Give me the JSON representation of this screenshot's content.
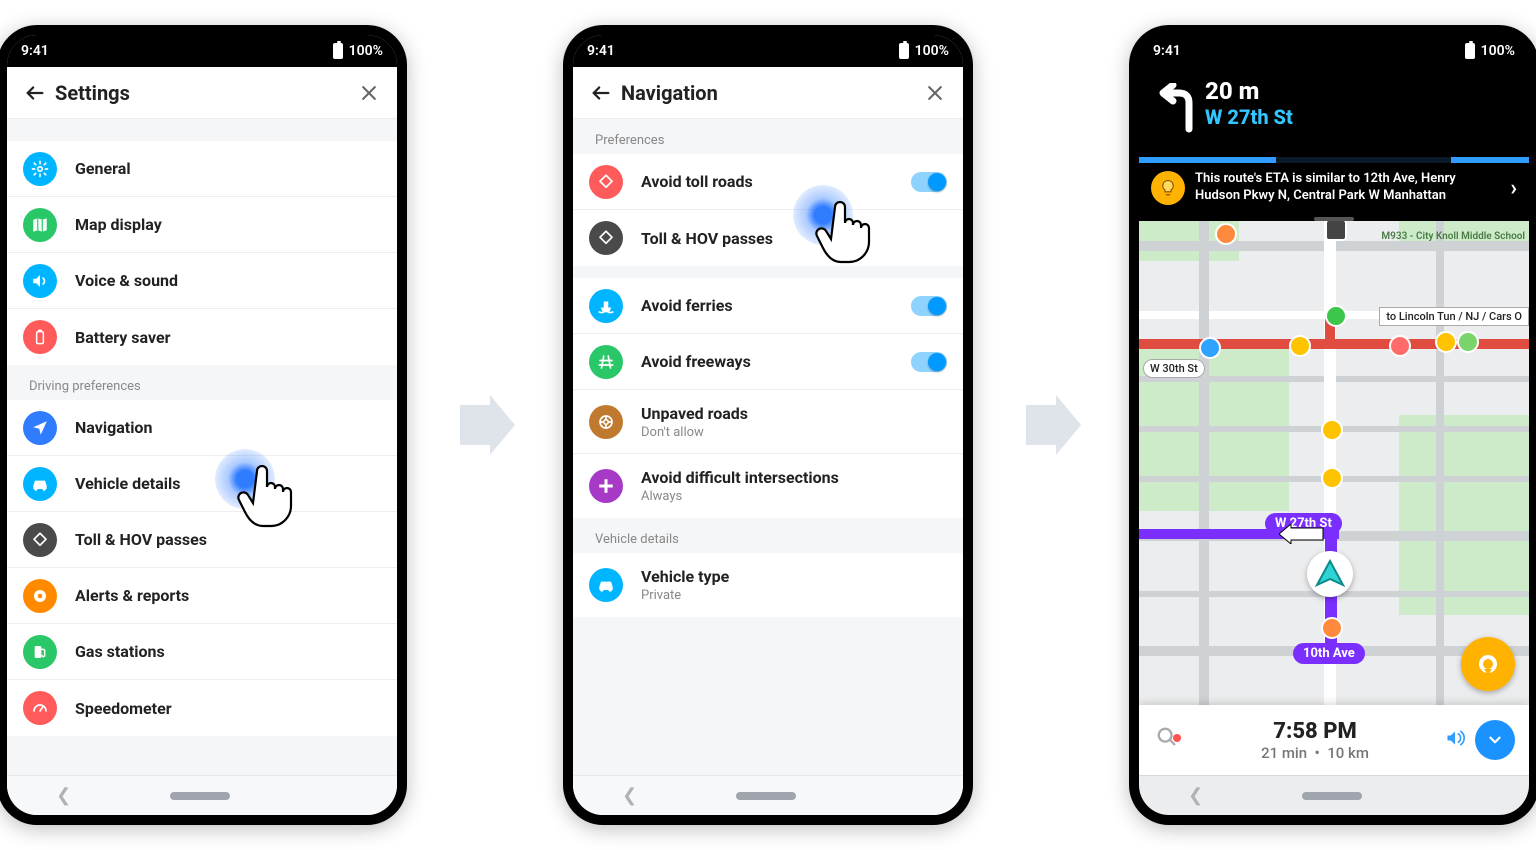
{
  "status": {
    "time": "9:41",
    "battery": "100%"
  },
  "phone1": {
    "title": "Settings",
    "section1": [
      {
        "icon": "gear",
        "color": "#00b5ff",
        "label": "General"
      },
      {
        "icon": "map",
        "color": "#2ac769",
        "label": "Map display"
      },
      {
        "icon": "sound",
        "color": "#00b5ff",
        "label": "Voice & sound"
      },
      {
        "icon": "batt",
        "color": "#ff5b5b",
        "label": "Battery saver"
      }
    ],
    "section2_label": "Driving preferences",
    "section2": [
      {
        "icon": "nav",
        "color": "#2f7cff",
        "label": "Navigation"
      },
      {
        "icon": "car",
        "color": "#00b5ff",
        "label": "Vehicle details"
      },
      {
        "icon": "toll",
        "color": "#4a4a4a",
        "label": "Toll & HOV passes"
      },
      {
        "icon": "alert",
        "color": "#ff8a00",
        "label": "Alerts & reports"
      },
      {
        "icon": "gas",
        "color": "#2ac769",
        "label": "Gas stations"
      },
      {
        "icon": "speed",
        "color": "#ff5b5b",
        "label": "Speedometer"
      }
    ]
  },
  "phone2": {
    "title": "Navigation",
    "section1_label": "Preferences",
    "prefs": [
      {
        "icon": "toll",
        "color": "#ff5b5b",
        "label": "Avoid toll roads",
        "toggle": true
      },
      {
        "icon": "tollhov",
        "color": "#4a4a4a",
        "label": "Toll & HOV passes"
      }
    ],
    "prefs2": [
      {
        "icon": "ferry",
        "color": "#00b5ff",
        "label": "Avoid ferries",
        "toggle": true
      },
      {
        "icon": "freeway",
        "color": "#2ac769",
        "label": "Avoid freeways",
        "toggle": true
      },
      {
        "icon": "dirt",
        "color": "#c07a2f",
        "label": "Unpaved roads",
        "sub": "Don't allow"
      },
      {
        "icon": "intersect",
        "color": "#a63ac7",
        "label": "Avoid difficult intersections",
        "sub": "Always"
      }
    ],
    "section3_label": "Vehicle details",
    "vehicle": {
      "icon": "car",
      "color": "#00b5ff",
      "label": "Vehicle type",
      "sub": "Private"
    }
  },
  "phone3": {
    "distance": "20 m",
    "street": "W 27th St",
    "banner": "This route's ETA is similar to 12th Ave, Henry Hudson Pkwy N, Central Park W Manhattan",
    "chip1": "W 27th St",
    "chip2": "10th Ave",
    "roadlabel1": "W 30th St",
    "roadlabel2": "to Lincoln Tun / NJ / Cars O",
    "school": "M933 - City Knoll Middle School",
    "eta_time": "7:58 PM",
    "eta_dur": "21 min",
    "eta_dist": "10 km"
  }
}
